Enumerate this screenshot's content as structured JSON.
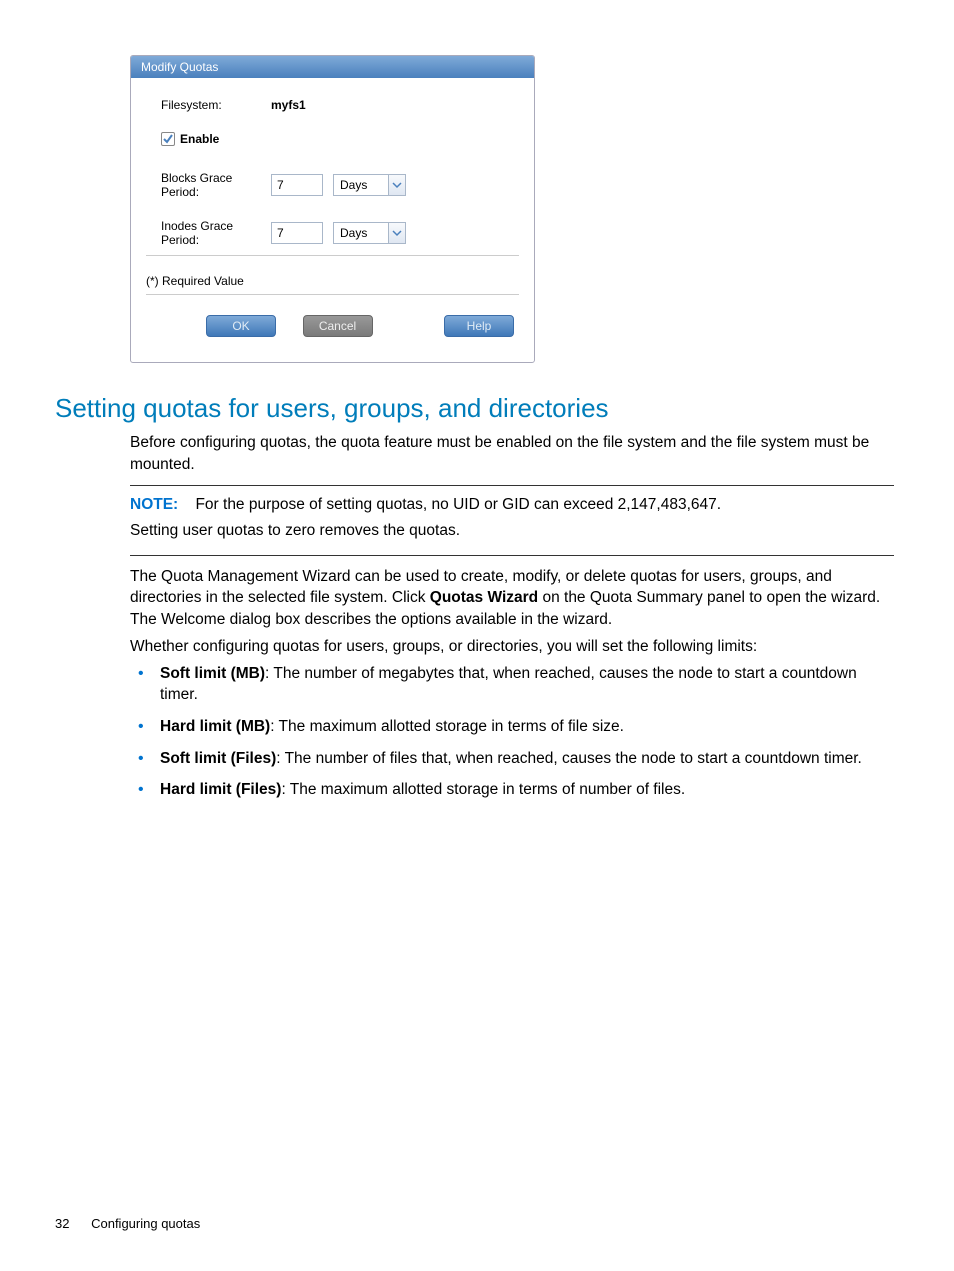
{
  "dialog": {
    "title": "Modify Quotas",
    "filesystem_label": "Filesystem:",
    "filesystem_value": "myfs1",
    "enable_label": "Enable",
    "blocks_label": "Blocks Grace Period:",
    "blocks_value": "7",
    "blocks_unit": "Days",
    "inodes_label": "Inodes Grace Period:",
    "inodes_value": "7",
    "inodes_unit": "Days",
    "required_text": "(*) Required Value",
    "ok": "OK",
    "cancel": "Cancel",
    "help": "Help"
  },
  "doc": {
    "heading": "Setting quotas for users, groups, and directories",
    "intro": "Before configuring quotas, the quota feature must be enabled on the file system and the file system must be mounted.",
    "note_label": "NOTE:",
    "note_line1": "For the purpose of setting quotas, no UID or GID can exceed 2,147,483,647.",
    "note_line2": "Setting user quotas to zero removes the quotas.",
    "para1_a": "The Quota Management Wizard can be used to create, modify, or delete quotas for users, groups, and directories in the selected file system. Click ",
    "para1_bold": "Quotas Wizard",
    "para1_b": " on the Quota Summary panel to open the wizard. The Welcome dialog box describes the options available in the wizard.",
    "para2": "Whether configuring quotas for users, groups, or directories, you will set the following limits:",
    "bullets": [
      {
        "bold": "Soft limit (MB)",
        "text": ": The number of megabytes that, when reached, causes the node to start a countdown timer."
      },
      {
        "bold": "Hard limit (MB)",
        "text": ": The maximum allotted storage in terms of file size."
      },
      {
        "bold": "Soft limit (Files)",
        "text": ": The number of files that, when reached, causes the node to start a countdown timer."
      },
      {
        "bold": "Hard limit (Files)",
        "text": ": The maximum allotted storage in terms of number of files."
      }
    ]
  },
  "footer": {
    "page": "32",
    "section": "Configuring quotas"
  }
}
